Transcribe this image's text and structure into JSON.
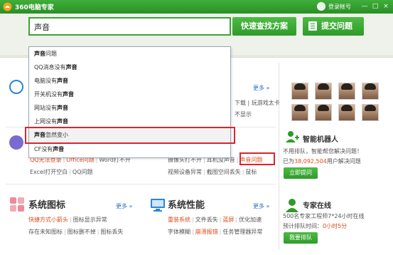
{
  "window": {
    "title": "360电脑专家",
    "login": "登录帐号",
    "controls": [
      "—",
      "□",
      "×"
    ]
  },
  "search": {
    "value": "声音",
    "search_button": "快速查找方案",
    "submit_button": "提交问题"
  },
  "suggestions": [
    {
      "pre": "",
      "bold": "声音",
      "post": "问题"
    },
    {
      "pre": "QQ消息没有",
      "bold": "声音",
      "post": ""
    },
    {
      "pre": "电脑没有",
      "bold": "声音",
      "post": ""
    },
    {
      "pre": "开关机没有",
      "bold": "声音",
      "post": ""
    },
    {
      "pre": "网站没有",
      "bold": "声音",
      "post": ""
    },
    {
      "pre": "上网没有",
      "bold": "声音",
      "post": ""
    },
    {
      "pre": "",
      "bold": "声音",
      "post": "忽然变小"
    },
    {
      "pre": "CF没有",
      "bold": "声音",
      "post": ""
    }
  ],
  "sections": {
    "top_left_more": "更多",
    "top_right_more": "更多",
    "top_right_lines": [
      [
        {
          "t": "下载 | 玩游戏太卡",
          "hot": false
        }
      ],
      [
        {
          "t": "不显示",
          "hot": false
        }
      ]
    ],
    "middle_left_lines": [
      [
        {
          "t": "QQ无法登录",
          "hot": true
        },
        {
          "t": "Office问题",
          "hot": true
        },
        {
          "t": "Word打不开",
          "hot": false
        }
      ],
      [
        {
          "t": "Excel打开空白",
          "hot": false
        },
        {
          "t": "QQ问题",
          "hot": false
        }
      ]
    ],
    "middle_right_lines": [
      [
        {
          "t": "摄像头打不开",
          "hot": false
        },
        {
          "t": "耳机没声音",
          "hot": false
        },
        {
          "t": "声音问题",
          "hot": true
        }
      ],
      [
        {
          "t": "视频设备异常",
          "hot": false
        },
        {
          "t": "截图空间丢失",
          "hot": false
        },
        {
          "t": "鼠标",
          "hot": false
        }
      ]
    ],
    "system_icons": {
      "title": "系统图标",
      "more": "更多",
      "lines": [
        [
          {
            "t": "快捷方式小箭头",
            "hot": true
          },
          {
            "t": "图标显示异常",
            "hot": false
          }
        ],
        [
          {
            "t": "存在未知图标",
            "hot": false
          },
          {
            "t": "图标删不掉",
            "hot": false
          },
          {
            "t": "图标丢失",
            "hot": false
          }
        ]
      ]
    },
    "system_performance": {
      "title": "系统性能",
      "more": "更多",
      "lines": [
        [
          {
            "t": "重装系统",
            "hot": true
          },
          {
            "t": "文件丢失",
            "hot": false
          },
          {
            "t": "蓝屏",
            "hot": true
          },
          {
            "t": "优化加速",
            "hot": false
          }
        ],
        [
          {
            "t": "字体模糊",
            "hot": false
          },
          {
            "t": "崩溃报错",
            "hot": true
          },
          {
            "t": "任务管理器异常",
            "hot": false
          }
        ]
      ]
    }
  },
  "robot": {
    "title": "智能机器人",
    "line1": "不用排队，智能帮您解决问题！",
    "line2_pre": "已为",
    "count": "38,092,504",
    "line2_post": "用户解决问题",
    "button": "立即提问"
  },
  "expert": {
    "title": "专家在线",
    "line1": "500名专家工程师7*24小时在线",
    "line2_pre": "预计排队时间：",
    "wait": "0小时5分",
    "button": "我要排队"
  },
  "colors": {
    "brand_green": "#2f9b2a",
    "hot_red": "#e04a1a",
    "highlight_box": "#d9262d",
    "link_blue": "#2a6fc9"
  }
}
